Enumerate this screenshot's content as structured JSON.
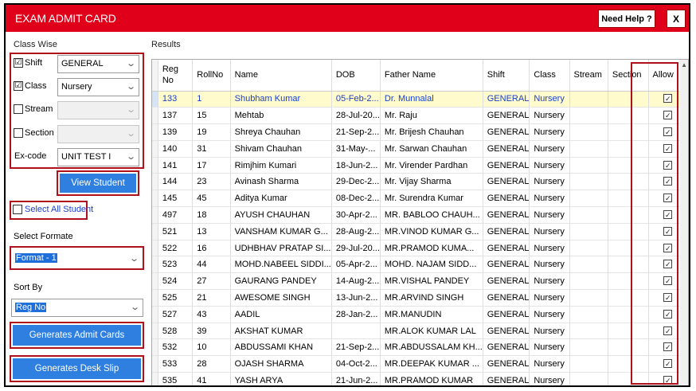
{
  "window": {
    "title": "EXAM ADMIT CARD",
    "help_label": "Need Help ?",
    "close_label": "X"
  },
  "filters": {
    "group_label": "Class Wise",
    "shift": {
      "label": "Shift",
      "checked": true,
      "value": "GENERAL"
    },
    "class": {
      "label": "Class",
      "checked": true,
      "value": "Nursery"
    },
    "stream": {
      "label": "Stream",
      "checked": false,
      "value": ""
    },
    "section": {
      "label": "Section",
      "checked": false,
      "value": ""
    },
    "excode": {
      "label": "Ex-code",
      "value": "UNIT TEST I"
    }
  },
  "view_student_label": "View Student",
  "select_all": {
    "label": "Select All Student",
    "checked": false
  },
  "select_format": {
    "label": "Select Formate",
    "value": "Format - 1"
  },
  "sort_by": {
    "label": "Sort By",
    "value": "Reg No"
  },
  "generate_admit_label": "Generates Admit Cards",
  "generate_desk_label": "Generates Desk Slip",
  "results": {
    "label": "Results",
    "columns": [
      "Reg\nNo",
      "RollNo",
      "Name",
      "DOB",
      "Father Name",
      "Shift",
      "Class",
      "Stream",
      "Section",
      "Allow"
    ],
    "rows": [
      [
        "133",
        "1",
        "Shubham Kumar",
        "05-Feb-2...",
        "Dr. Munnalal",
        "GENERAL",
        "Nursery",
        "",
        ""
      ],
      [
        "137",
        "15",
        "Mehtab",
        "28-Jul-20...",
        "Mr. Raju",
        "GENERAL",
        "Nursery",
        "",
        ""
      ],
      [
        "139",
        "19",
        "Shreya Chauhan",
        "21-Sep-2...",
        "Mr. Brijesh Chauhan",
        "GENERAL",
        "Nursery",
        "",
        ""
      ],
      [
        "140",
        "31",
        "Shivam Chauhan",
        "31-May-...",
        "Mr. Sarwan Chauhan",
        "GENERAL",
        "Nursery",
        "",
        ""
      ],
      [
        "141",
        "17",
        "Rimjhim Kumari",
        "18-Jun-2...",
        "Mr. Virender Pardhan",
        "GENERAL",
        "Nursery",
        "",
        ""
      ],
      [
        "144",
        "23",
        "Avinash Sharma",
        "29-Dec-2...",
        "Mr. Vijay Sharma",
        "GENERAL",
        "Nursery",
        "",
        ""
      ],
      [
        "145",
        "45",
        "Aditya Kumar",
        "08-Dec-2...",
        "Mr. Surendra Kumar",
        "GENERAL",
        "Nursery",
        "",
        ""
      ],
      [
        "497",
        "18",
        "AYUSH CHAUHAN",
        "30-Apr-2...",
        "MR. BABLOO CHAUH...",
        "GENERAL",
        "Nursery",
        "",
        ""
      ],
      [
        "521",
        "13",
        "VANSHAM KUMAR G...",
        "28-Aug-2...",
        "MR.VINOD KUMAR G...",
        "GENERAL",
        "Nursery",
        "",
        ""
      ],
      [
        "522",
        "16",
        "UDHBHAV PRATAP SI...",
        "29-Jul-20...",
        "MR.PRAMOD KUMA...",
        "GENERAL",
        "Nursery",
        "",
        ""
      ],
      [
        "523",
        "44",
        "MOHD.NABEEL SIDDI...",
        "05-Apr-2...",
        "MOHD. NAJAM SIDD...",
        "GENERAL",
        "Nursery",
        "",
        ""
      ],
      [
        "524",
        "27",
        "GAURANG PANDEY",
        "14-Aug-2...",
        "MR.VISHAL PANDEY",
        "GENERAL",
        "Nursery",
        "",
        ""
      ],
      [
        "525",
        "21",
        "AWESOME SINGH",
        "13-Jun-2...",
        "MR.ARVIND SINGH",
        "GENERAL",
        "Nursery",
        "",
        ""
      ],
      [
        "527",
        "43",
        "AADIL",
        "28-Jan-2...",
        "MR.MANUDIN",
        "GENERAL",
        "Nursery",
        "",
        ""
      ],
      [
        "528",
        "39",
        "AKSHAT KUMAR",
        "",
        "MR.ALOK KUMAR LAL",
        "GENERAL",
        "Nursery",
        "",
        ""
      ],
      [
        "532",
        "10",
        "ABDUSSAMI KHAN",
        "21-Sep-2...",
        "MR.ABDUSSALAM KH...",
        "GENERAL",
        "Nursery",
        "",
        ""
      ],
      [
        "533",
        "28",
        "OJASH SHARMA",
        "04-Oct-2...",
        "MR.DEEPAK KUMAR ...",
        "GENERAL",
        "Nursery",
        "",
        ""
      ],
      [
        "535",
        "41",
        "YASH ARYA",
        "21-Jun-2...",
        "MR.PRAMOD KUMAR",
        "GENERAL",
        "Nursery",
        "",
        ""
      ]
    ],
    "allow_all_checked": true,
    "selected_row": 0
  },
  "check_glyph": "☑",
  "accent_colors": {
    "titlebar": "#e0001a",
    "button": "#2f7fe0",
    "highlight": "#b0101a"
  }
}
